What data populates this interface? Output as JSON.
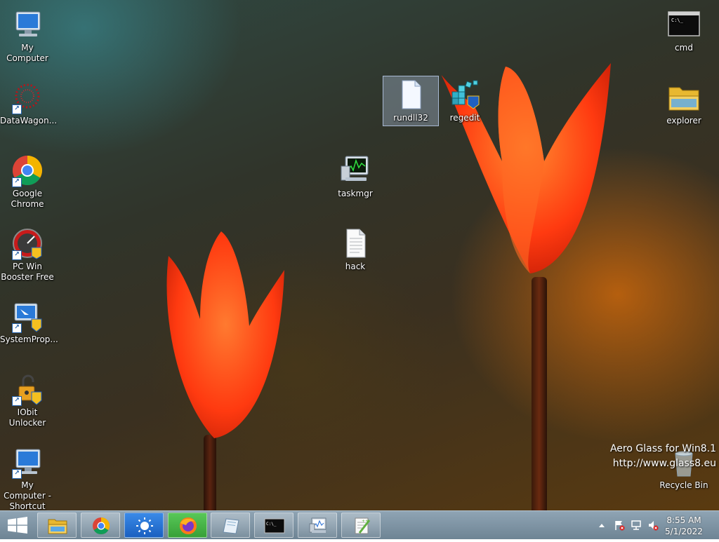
{
  "desktop_icons": {
    "my_computer": "My Computer",
    "datawagon": "DataWagon...",
    "google_chrome": "Google Chrome",
    "pc_win_booster": "PC Win Booster Free",
    "system_prop": "SystemProp...",
    "iobit_unlocker": "IObit Unlocker",
    "my_computer_shortcut": "My Computer - Shortcut",
    "rundll32": "rundll32",
    "regedit": "regedit",
    "taskmgr": "taskmgr",
    "hack": "hack",
    "cmd": "cmd",
    "explorer": "explorer",
    "recycle_bin": "Recycle Bin"
  },
  "watermark": {
    "line1": "Aero Glass for Win8.1",
    "line2": "http://www.glass8.eu"
  },
  "taskbar": {
    "clock_time": "8:55 AM",
    "clock_date": "5/1/2022"
  },
  "colors": {
    "accent": "#1e5ea8",
    "taskbar": "#7d92a2",
    "tulip": "#ff4a10"
  }
}
